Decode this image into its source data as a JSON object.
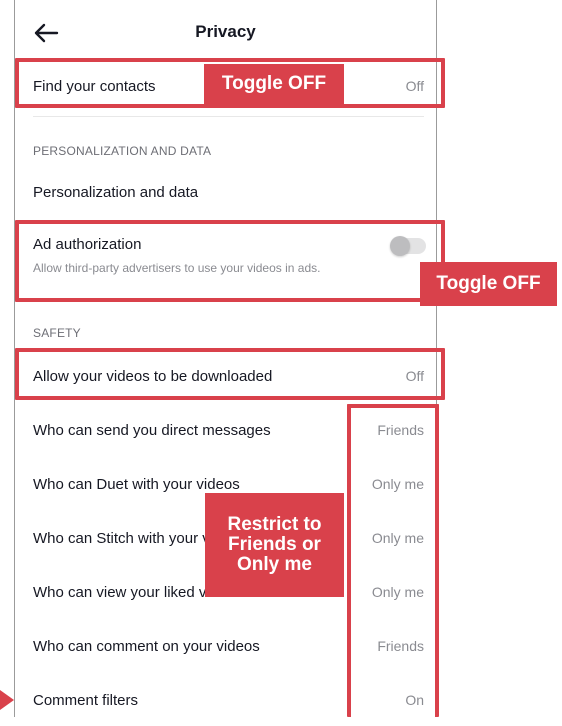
{
  "header": {
    "title": "Privacy"
  },
  "rows": {
    "find_contacts": {
      "label": "Find your contacts",
      "value": "Off"
    },
    "personalization": {
      "label": "Personalization and data"
    },
    "ad_authorization": {
      "label": "Ad authorization",
      "description": "Allow third-party advertisers to use your videos in ads.",
      "toggle_state": "off"
    },
    "downloads": {
      "label": "Allow your videos to be downloaded",
      "value": "Off"
    },
    "direct_messages": {
      "label": "Who can send you direct messages",
      "value": "Friends"
    },
    "duet": {
      "label": "Who can Duet with your videos",
      "value": "Only me"
    },
    "stitch": {
      "label": "Who can Stitch with your videos",
      "value": "Only me"
    },
    "liked_videos": {
      "label": "Who can view your liked videos",
      "value": "Only me"
    },
    "comment": {
      "label": "Who can comment on your videos",
      "value": "Friends"
    },
    "comment_filters": {
      "label": "Comment filters",
      "value": "On"
    }
  },
  "sections": {
    "personalization": "PERSONALIZATION AND DATA",
    "safety": "SAFETY"
  },
  "annotations": {
    "toggle_off_1": "Toggle OFF",
    "toggle_off_2": "Toggle OFF",
    "restrict_line1": "Restrict to",
    "restrict_line2": "Friends or",
    "restrict_line3": "Only me"
  },
  "colors": {
    "annotation_red": "#d9414b",
    "text_primary": "#161823",
    "text_secondary": "#8a8b91"
  },
  "icons": {
    "back": "arrow-left-icon",
    "pointer": "red-arrow-icon"
  }
}
